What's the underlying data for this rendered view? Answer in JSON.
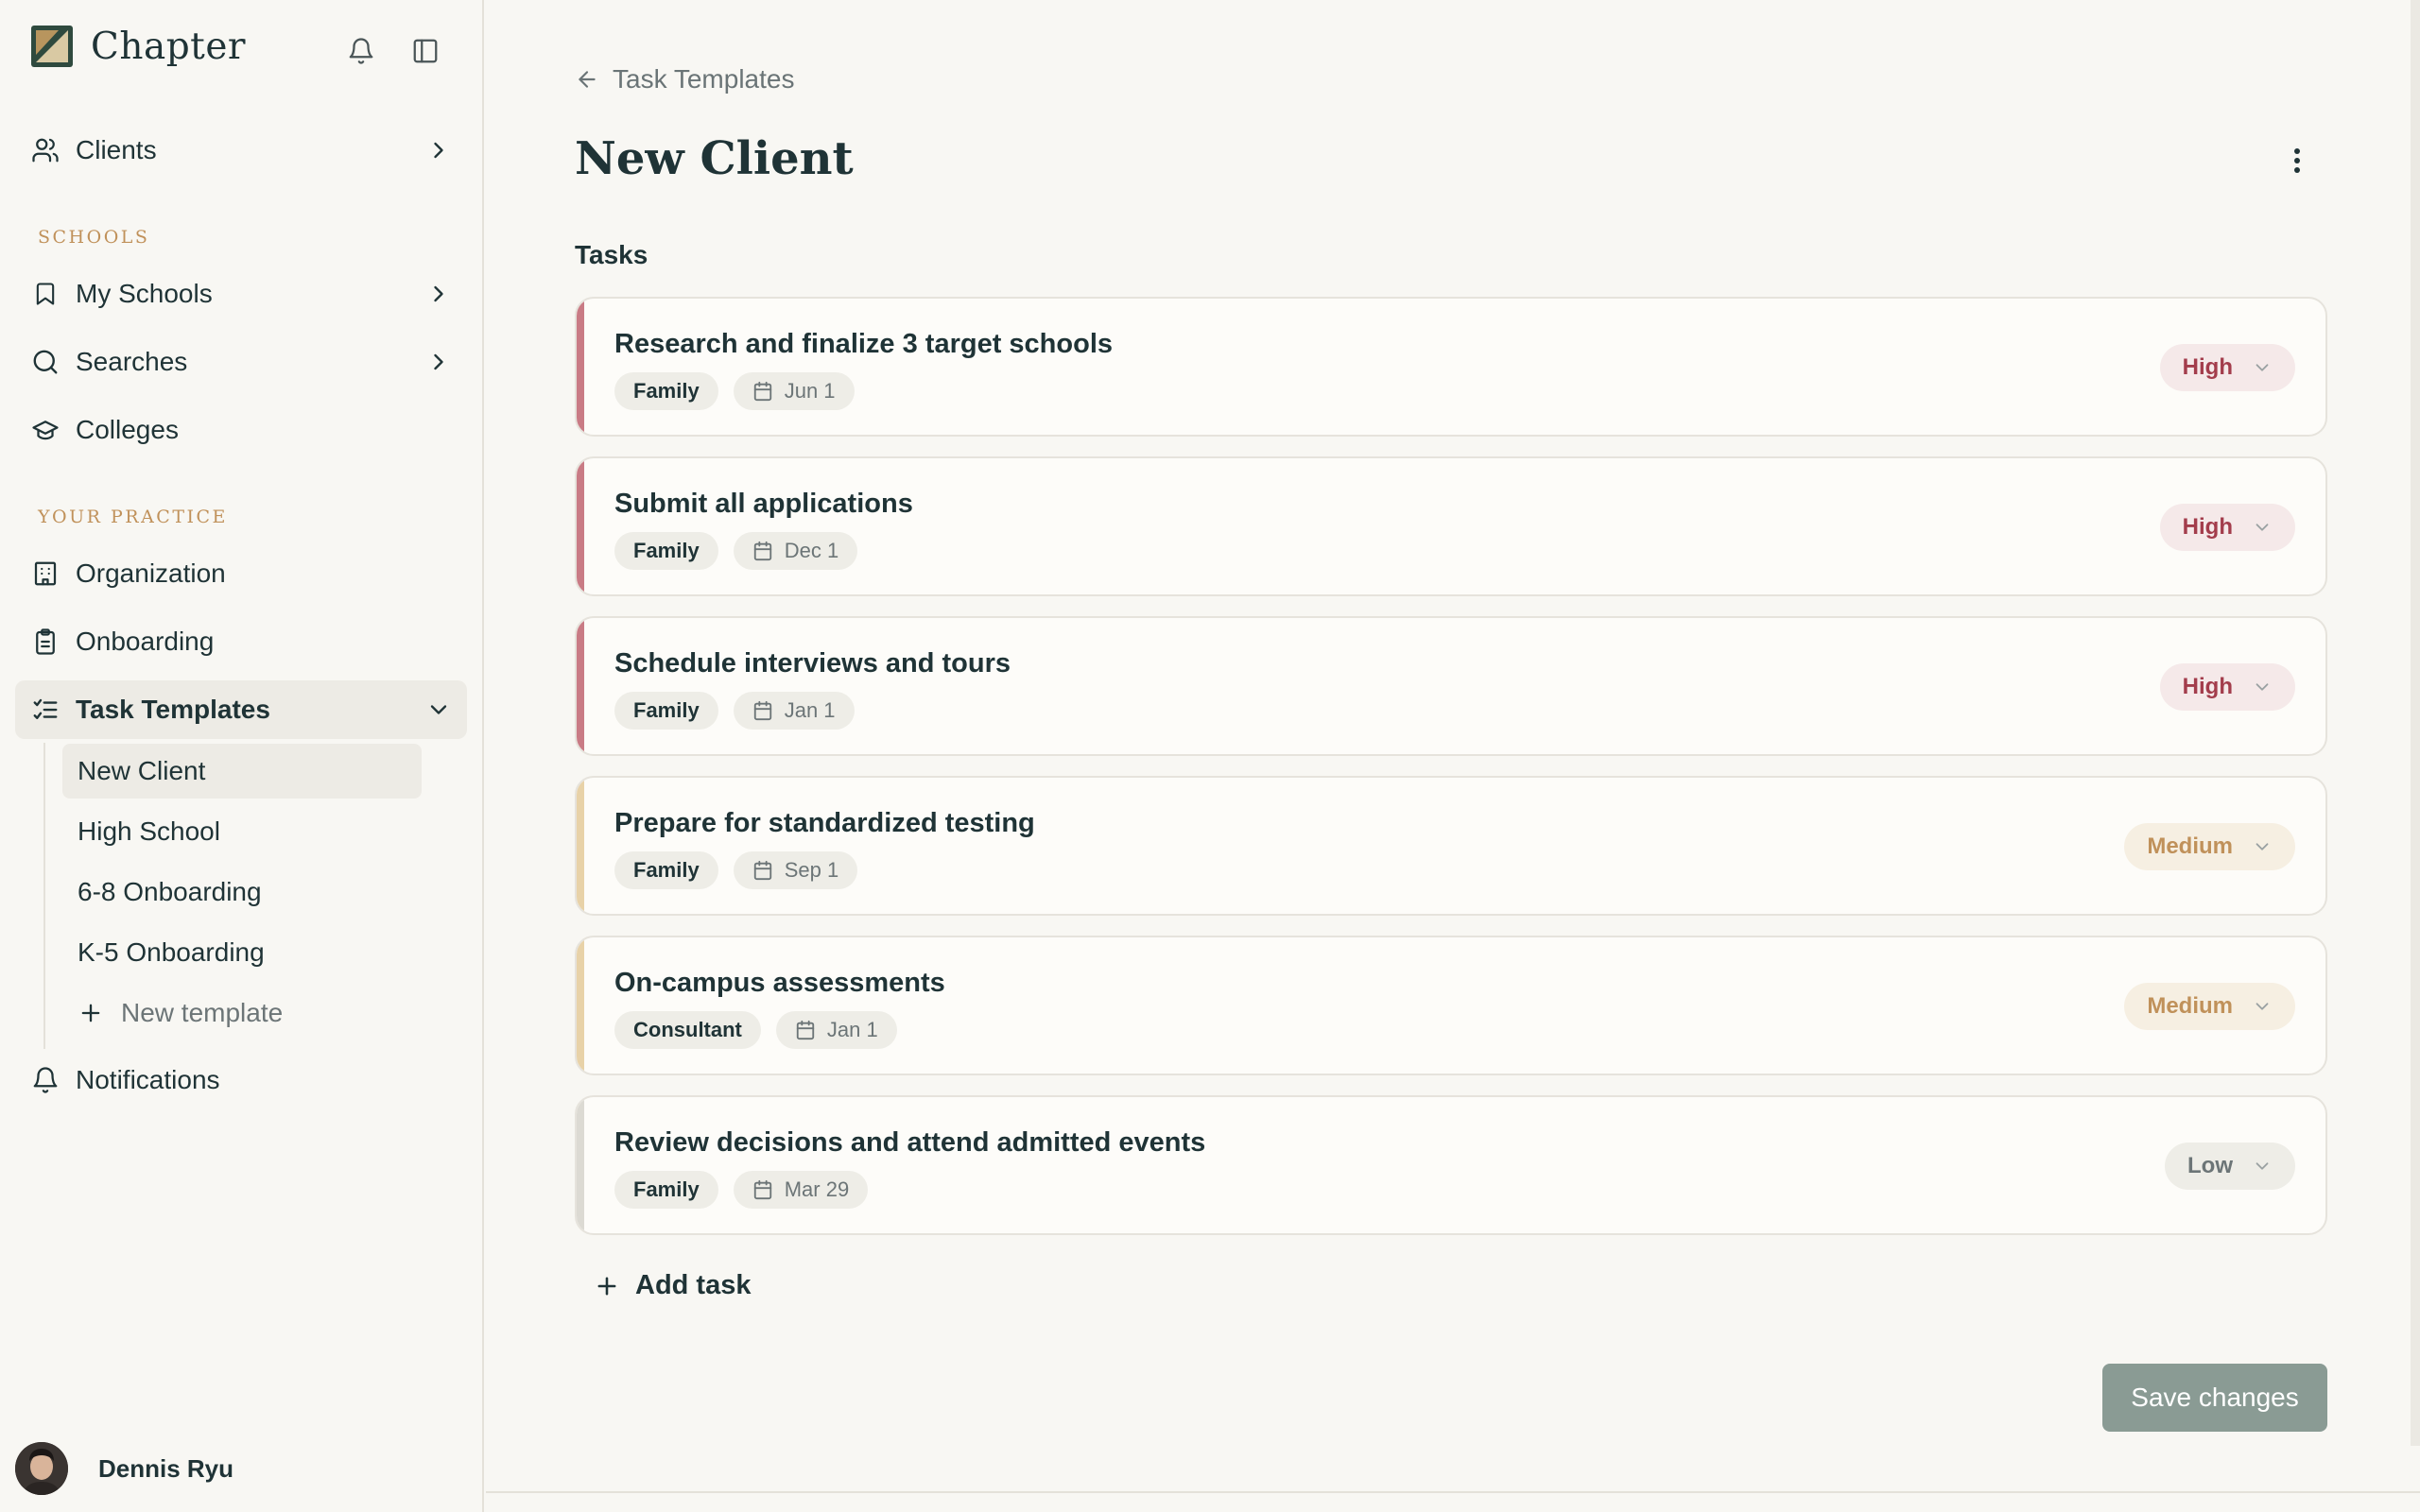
{
  "app": {
    "brand": "Chapter"
  },
  "sidebar": {
    "clients": "Clients",
    "schools_section": "SCHOOLS",
    "my_schools": "My Schools",
    "searches": "Searches",
    "colleges": "Colleges",
    "practice_section": "YOUR PRACTICE",
    "organization": "Organization",
    "onboarding": "Onboarding",
    "task_templates": "Task Templates",
    "templates": [
      "New Client",
      "High School",
      "6-8 Onboarding",
      "K-5 Onboarding"
    ],
    "new_template": "New template",
    "notifications": "Notifications",
    "user_name": "Dennis Ryu"
  },
  "main": {
    "back_label": "Task Templates",
    "title": "New Client",
    "section_title": "Tasks",
    "tasks": [
      {
        "title": "Research and finalize 3 target schools",
        "assignee": "Family",
        "date": "Jun 1",
        "priority": "High"
      },
      {
        "title": "Submit all applications",
        "assignee": "Family",
        "date": "Dec 1",
        "priority": "High"
      },
      {
        "title": "Schedule interviews and tours",
        "assignee": "Family",
        "date": "Jan 1",
        "priority": "High"
      },
      {
        "title": "Prepare for standardized testing",
        "assignee": "Family",
        "date": "Sep 1",
        "priority": "Medium"
      },
      {
        "title": "On-campus assessments",
        "assignee": "Consultant",
        "date": "Jan 1",
        "priority": "Medium"
      },
      {
        "title": "Review decisions and attend admitted events",
        "assignee": "Family",
        "date": "Mar 29",
        "priority": "Low"
      }
    ],
    "add_task": "Add task",
    "save": "Save changes"
  },
  "colors": {
    "high": "#c97b85",
    "medium": "#e8d2a8",
    "low": "#dcdad3",
    "save_button": "#8a9b94"
  }
}
